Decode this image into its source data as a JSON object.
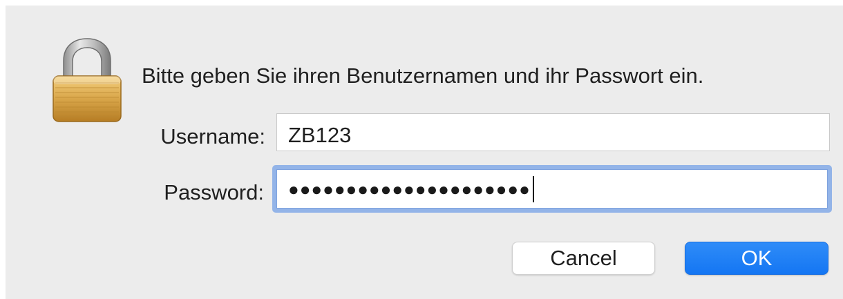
{
  "dialog": {
    "message": "Bitte geben Sie ihren Benutzernamen und ihr Passwort ein.",
    "icon": "padlock-icon"
  },
  "fields": {
    "username_label": "Username:",
    "username_value": "ZB123",
    "password_label": "Password:",
    "password_masked": "●●●●●●●●●●●●●●●●●●●●●"
  },
  "buttons": {
    "cancel_label": "Cancel",
    "ok_label": "OK"
  },
  "colors": {
    "accent": "#1a7cf5",
    "focus_ring": "#93b4e8",
    "dialog_background": "#ececec"
  }
}
